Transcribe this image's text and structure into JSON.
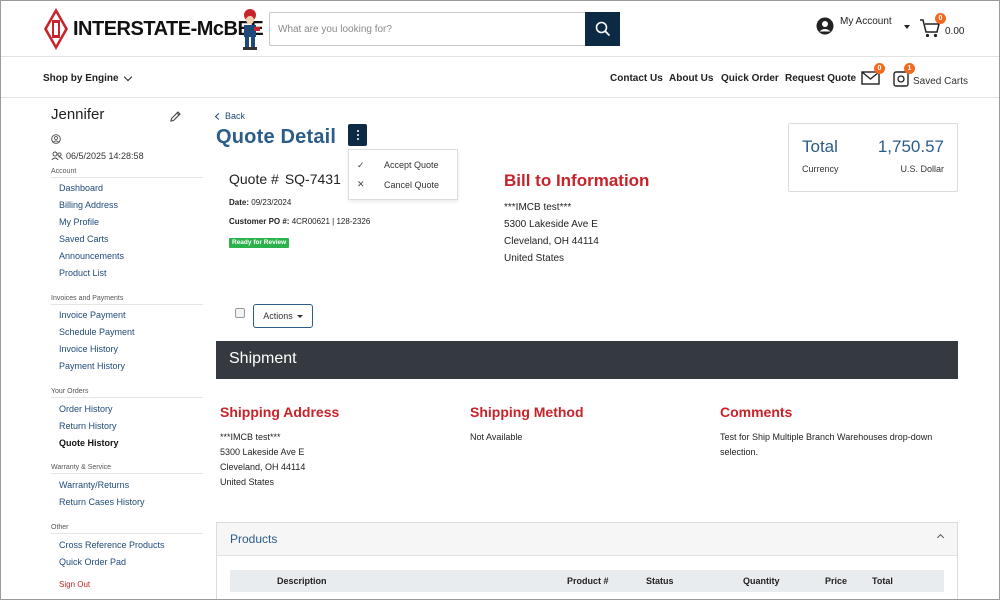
{
  "header": {
    "brand": "INTERSTATE-McBEE",
    "search_placeholder": "What are you looking for?",
    "account_label": "My Account",
    "cart_count": "0",
    "cart_total": "0.00"
  },
  "nav": {
    "shop_by_engine": "Shop by Engine",
    "links": [
      "Contact Us",
      "About Us",
      "Quick Order",
      "Request Quote"
    ],
    "messages_count": "0",
    "saved_carts_count": "1",
    "saved_carts_label": "Saved Carts"
  },
  "sidebar": {
    "user_name": "Jennifer",
    "last_login": "06/5/2025 14:28:58",
    "sections": [
      {
        "title": "Account",
        "items": [
          "Dashboard",
          "Billing Address",
          "My Profile",
          "Saved Carts",
          "Announcements",
          "Product List"
        ]
      },
      {
        "title": "Invoices and Payments",
        "items": [
          "Invoice Payment",
          "Schedule Payment",
          "Invoice History",
          "Payment History"
        ]
      },
      {
        "title": "Your Orders",
        "items": [
          "Order History",
          "Return History",
          "Quote History"
        ]
      },
      {
        "title": "Warranty & Service",
        "items": [
          "Warranty/Returns",
          "Return Cases History"
        ]
      },
      {
        "title": "Other",
        "items": [
          "Cross Reference Products",
          "Quick Order Pad"
        ]
      }
    ],
    "active_item": "Quote History",
    "sign_out": "Sign Out"
  },
  "main": {
    "back_label": "Back",
    "page_title": "Quote Detail",
    "menu": {
      "accept": "Accept Quote",
      "cancel": "Cancel Quote"
    },
    "quote_label": "Quote #",
    "quote_number": "SQ-7431",
    "date_label": "Date:",
    "date_value": "09/23/2024",
    "po_label": "Customer PO #:",
    "po_value": "4CR00621 | 128-2326",
    "status": "Ready for Review",
    "bill_title": "Bill to Information",
    "bill_lines": [
      "***IMCB test***",
      "5300 Lakeside Ave E",
      "Cleveland, OH 44114",
      "United States"
    ],
    "total_label": "Total",
    "total_amount": "1,750.57",
    "currency_label": "Currency",
    "currency_value": "U.S. Dollar",
    "actions_label": "Actions"
  },
  "shipment": {
    "title": "Shipment",
    "address_title": "Shipping Address",
    "address_lines": [
      "***IMCB test***",
      "5300 Lakeside Ave E",
      "Cleveland, OH 44114",
      "United States"
    ],
    "method_title": "Shipping Method",
    "method_value": "Not Available",
    "comments_title": "Comments",
    "comments_lines": [
      "Test for Ship Multiple Branch Warehouses drop-down",
      "selection."
    ]
  },
  "products": {
    "title": "Products",
    "columns": [
      "Description",
      "Product #",
      "Status",
      "Quantity",
      "Price",
      "Total"
    ]
  },
  "colors": {
    "navy": "#0d2a45",
    "blue": "#2a5d8a",
    "red": "#c8222a",
    "orange": "#f26a21",
    "green": "#2bb24c",
    "dark_bar": "#353a40"
  }
}
